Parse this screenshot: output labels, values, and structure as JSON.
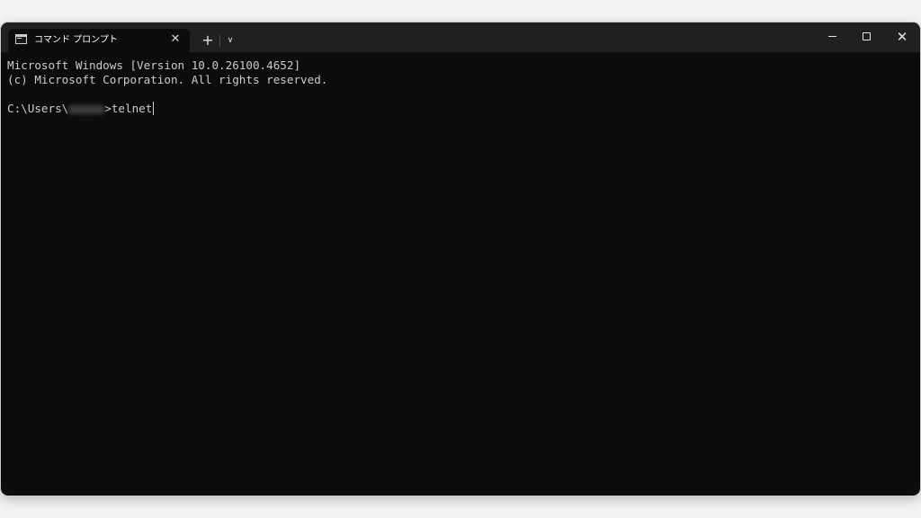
{
  "tab": {
    "title": "コマンド プロンプト",
    "icon": "command-prompt-icon"
  },
  "tabbar": {
    "new_tab_icon": "plus-icon",
    "dropdown_icon": "chevron-down-icon"
  },
  "window_controls": {
    "minimize_icon": "minimize-icon",
    "maximize_icon": "maximize-icon",
    "close_icon": "close-icon"
  },
  "console": {
    "lines": [
      "Microsoft Windows [Version 10.0.26100.4652]",
      "(c) Microsoft Corporation. All rights reserved."
    ],
    "prompt_prefix": "C:\\Users\\",
    "prompt_suffix": ">",
    "command": "telnet"
  },
  "colors": {
    "background": "#0c0c0c",
    "titlebar": "#202020",
    "text": "#cccccc"
  }
}
